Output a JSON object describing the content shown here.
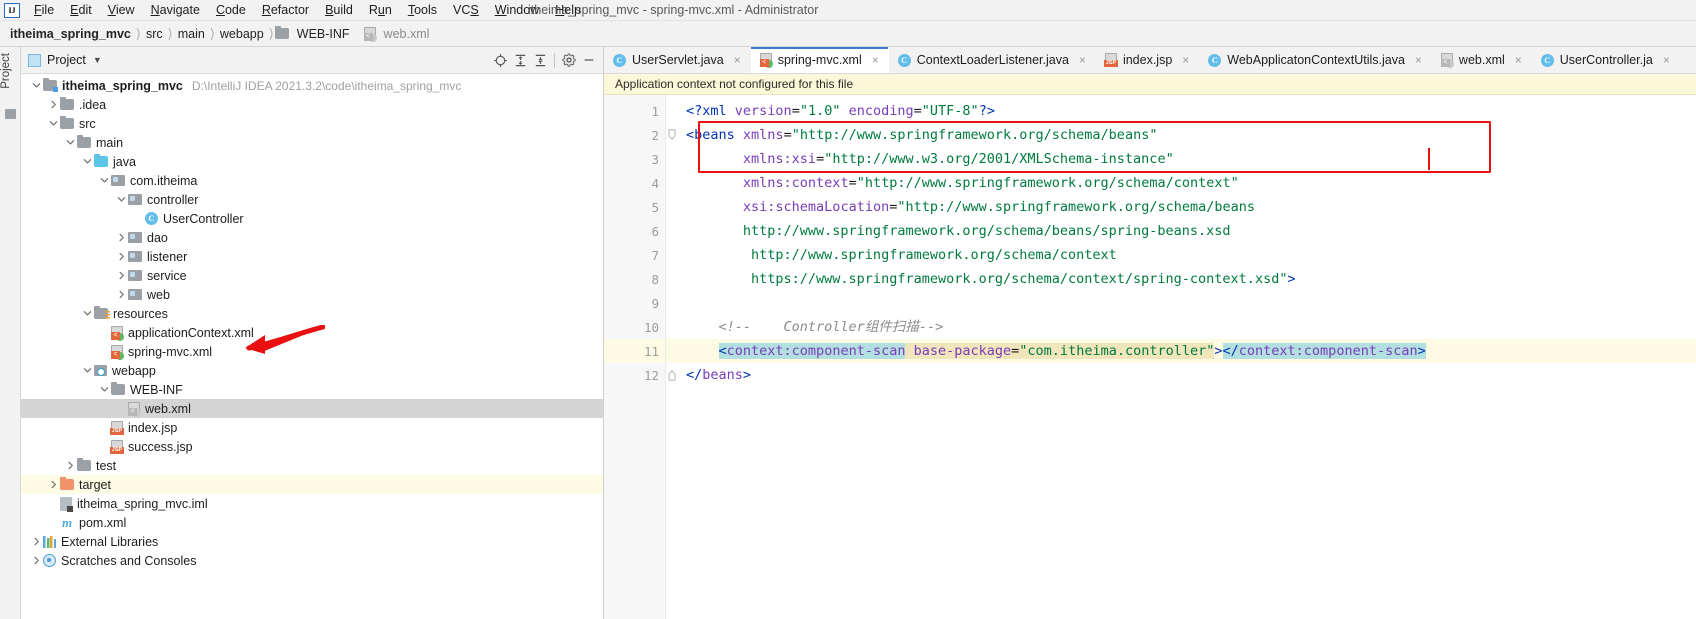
{
  "window": {
    "title": "itheima_spring_mvc - spring-mvc.xml - Administrator",
    "logo": "IJ"
  },
  "menubar": {
    "items": [
      {
        "label": "File",
        "mnemonic": "F"
      },
      {
        "label": "Edit",
        "mnemonic": "E"
      },
      {
        "label": "View",
        "mnemonic": "V"
      },
      {
        "label": "Navigate",
        "mnemonic": "N"
      },
      {
        "label": "Code",
        "mnemonic": "C"
      },
      {
        "label": "Refactor",
        "mnemonic": "R"
      },
      {
        "label": "Build",
        "mnemonic": "B"
      },
      {
        "label": "Run",
        "mnemonic": "u"
      },
      {
        "label": "Tools",
        "mnemonic": "T"
      },
      {
        "label": "VCS",
        "mnemonic": "S"
      },
      {
        "label": "Window",
        "mnemonic": "W"
      },
      {
        "label": "Help",
        "mnemonic": "H"
      }
    ]
  },
  "breadcrumb": {
    "items": [
      {
        "label": "itheima_spring_mvc",
        "style": "bold",
        "icon": ""
      },
      {
        "label": "src",
        "style": "normal",
        "icon": ""
      },
      {
        "label": "main",
        "style": "normal",
        "icon": ""
      },
      {
        "label": "webapp",
        "style": "normal",
        "icon": ""
      },
      {
        "label": "WEB-INF",
        "style": "normal",
        "icon": "folder-icon"
      },
      {
        "label": "web.xml",
        "style": "muted",
        "icon": "xml-file-icon"
      }
    ]
  },
  "toolstrip": {
    "label": "Project"
  },
  "project_panel": {
    "title": "Project",
    "toolbar_icons": [
      "locate-icon",
      "expand-all-icon",
      "collapse-all-icon",
      "settings-icon",
      "hide-icon"
    ],
    "tree": [
      {
        "depth": 0,
        "arrow": "down",
        "icon": "module-folder-icon",
        "label": "itheima_spring_mvc",
        "bold": true,
        "path": "D:\\IntelliJ IDEA 2021.3.2\\code\\itheima_spring_mvc",
        "state": "none"
      },
      {
        "depth": 1,
        "arrow": "right",
        "icon": "folder-icon",
        "label": ".idea",
        "bold": false,
        "path": "",
        "state": "none"
      },
      {
        "depth": 1,
        "arrow": "down",
        "icon": "folder-icon",
        "label": "src",
        "bold": false,
        "path": "",
        "state": "none"
      },
      {
        "depth": 2,
        "arrow": "down",
        "icon": "folder-icon",
        "label": "main",
        "bold": false,
        "path": "",
        "state": "none"
      },
      {
        "depth": 3,
        "arrow": "down",
        "icon": "source-folder-icon",
        "label": "java",
        "bold": false,
        "path": "",
        "state": "none"
      },
      {
        "depth": 4,
        "arrow": "down",
        "icon": "package-icon",
        "label": "com.itheima",
        "bold": false,
        "path": "",
        "state": "none"
      },
      {
        "depth": 5,
        "arrow": "down",
        "icon": "package-icon",
        "label": "controller",
        "bold": false,
        "path": "",
        "state": "none"
      },
      {
        "depth": 6,
        "arrow": "none",
        "icon": "java-class-icon",
        "label": "UserController",
        "bold": false,
        "path": "",
        "state": "none"
      },
      {
        "depth": 5,
        "arrow": "right",
        "icon": "package-icon",
        "label": "dao",
        "bold": false,
        "path": "",
        "state": "none"
      },
      {
        "depth": 5,
        "arrow": "right",
        "icon": "package-icon",
        "label": "listener",
        "bold": false,
        "path": "",
        "state": "none"
      },
      {
        "depth": 5,
        "arrow": "right",
        "icon": "package-icon",
        "label": "service",
        "bold": false,
        "path": "",
        "state": "none"
      },
      {
        "depth": 5,
        "arrow": "right",
        "icon": "package-icon",
        "label": "web",
        "bold": false,
        "path": "",
        "state": "none"
      },
      {
        "depth": 3,
        "arrow": "down",
        "icon": "resources-folder-icon",
        "label": "resources",
        "bold": false,
        "path": "",
        "state": "none"
      },
      {
        "depth": 4,
        "arrow": "none",
        "icon": "spring-xml-icon",
        "label": "applicationContext.xml",
        "bold": false,
        "path": "",
        "state": "none"
      },
      {
        "depth": 4,
        "arrow": "none",
        "icon": "spring-xml-icon",
        "label": "spring-mvc.xml",
        "bold": false,
        "path": "",
        "state": "none"
      },
      {
        "depth": 3,
        "arrow": "down",
        "icon": "webapp-folder-icon",
        "label": "webapp",
        "bold": false,
        "path": "",
        "state": "none"
      },
      {
        "depth": 4,
        "arrow": "down",
        "icon": "folder-icon",
        "label": "WEB-INF",
        "bold": false,
        "path": "",
        "state": "none"
      },
      {
        "depth": 5,
        "arrow": "none",
        "icon": "xml-file-icon",
        "label": "web.xml",
        "bold": false,
        "path": "",
        "state": "selected"
      },
      {
        "depth": 4,
        "arrow": "none",
        "icon": "jsp-file-icon",
        "label": "index.jsp",
        "bold": false,
        "path": "",
        "state": "none"
      },
      {
        "depth": 4,
        "arrow": "none",
        "icon": "jsp-file-icon",
        "label": "success.jsp",
        "bold": false,
        "path": "",
        "state": "none"
      },
      {
        "depth": 2,
        "arrow": "right",
        "icon": "folder-icon",
        "label": "test",
        "bold": false,
        "path": "",
        "state": "none"
      },
      {
        "depth": 1,
        "arrow": "right",
        "icon": "target-folder-icon",
        "label": "target",
        "bold": false,
        "path": "",
        "state": "highlight"
      },
      {
        "depth": 1,
        "arrow": "none",
        "icon": "iml-file-icon",
        "label": "itheima_spring_mvc.iml",
        "bold": false,
        "path": "",
        "state": "none"
      },
      {
        "depth": 1,
        "arrow": "none",
        "icon": "maven-pom-icon",
        "label": "pom.xml",
        "bold": false,
        "path": "",
        "state": "none"
      },
      {
        "depth": 0,
        "arrow": "right",
        "icon": "external-libraries-icon",
        "label": "External Libraries",
        "bold": false,
        "path": "",
        "state": "none"
      },
      {
        "depth": 0,
        "arrow": "right",
        "icon": "scratches-icon",
        "label": "Scratches and Consoles",
        "bold": false,
        "path": "",
        "state": "none"
      }
    ]
  },
  "editor": {
    "tabs": [
      {
        "label": "UserServlet.java",
        "icon": "java-class-icon",
        "active": false
      },
      {
        "label": "spring-mvc.xml",
        "icon": "spring-xml-icon",
        "active": true
      },
      {
        "label": "ContextLoaderListener.java",
        "icon": "java-class-icon",
        "active": false
      },
      {
        "label": "index.jsp",
        "icon": "jsp-file-icon",
        "active": false
      },
      {
        "label": "WebApplicatonContextUtils.java",
        "icon": "java-class-icon",
        "active": false
      },
      {
        "label": "web.xml",
        "icon": "xml-file-icon",
        "active": false
      },
      {
        "label": "UserController.ja",
        "icon": "java-class-icon",
        "active": false
      }
    ],
    "close_glyph": "×",
    "notification": "Application context not configured for this file",
    "line_numbers": [
      "1",
      "2",
      "3",
      "4",
      "5",
      "6",
      "7",
      "8",
      "9",
      "10",
      "11",
      "12"
    ],
    "gutter_bean_line": 11,
    "highlighted_line": 11,
    "code_lines": [
      "<?xml version=\"1.0\" encoding=\"UTF-8\"?>",
      "<beans xmlns=\"http://www.springframework.org/schema/beans\"",
      "       xmlns:xsi=\"http://www.w3.org/2001/XMLSchema-instance\"",
      "       xmlns:context=\"http://www.springframework.org/schema/context\"",
      "       xsi:schemaLocation=\"http://www.springframework.org/schema/beans",
      "       http://www.springframework.org/schema/beans/spring-beans.xsd",
      "        http://www.springframework.org/schema/context",
      "        https://www.springframework.org/schema/context/spring-context.xsd\">",
      "",
      "    <!--    Controller组件扫描-->",
      "    <context:component-scan base-package=\"com.itheima.controller\"></context:component-scan>",
      "</beans>"
    ],
    "annotation": {
      "type": "red-rectangle",
      "covers_lines": [
        10,
        11
      ],
      "color": "#e81010"
    },
    "tree_arrow_annotation": {
      "type": "red-arrow",
      "points_at": "spring-mvc.xml",
      "color": "#e81010"
    }
  },
  "colors": {
    "accent": "#3c7cd1",
    "annotation_red": "#e81010",
    "selection_teal": "#b2e0e0",
    "selection_value": "#f0e5bb",
    "notification_bg": "#fcf7d8",
    "tree_selected": "#d4d4d4",
    "tree_highlight": "#fdfbe4"
  }
}
